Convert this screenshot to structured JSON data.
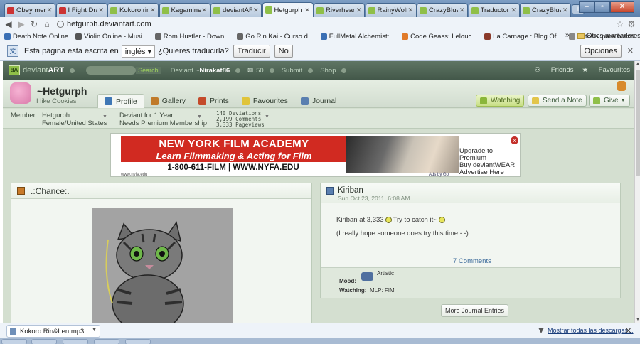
{
  "browser": {
    "tabs": [
      {
        "title": "Obey mem",
        "color": "#cc3333"
      },
      {
        "title": "I Fight Drag",
        "color": "#cc3333"
      },
      {
        "title": "Kokoro rin l",
        "color": "#8fbf48"
      },
      {
        "title": "Kagamine l",
        "color": "#8fbf48"
      },
      {
        "title": "deviantART",
        "color": "#8fbf48"
      },
      {
        "title": "Hetgurph o",
        "color": "#8fbf48",
        "active": true
      },
      {
        "title": "RiverheartS",
        "color": "#8fbf48"
      },
      {
        "title": "RainyWolfe",
        "color": "#8fbf48"
      },
      {
        "title": "CrazyBlueC",
        "color": "#8fbf48"
      },
      {
        "title": "Traductor d",
        "color": "#8fbf48"
      },
      {
        "title": "CrazyBlueC",
        "color": "#8fbf48"
      }
    ],
    "url": "hetgurph.deviantart.com",
    "bookmarks": [
      {
        "label": "Death Note Online",
        "color": "#3a6fb4"
      },
      {
        "label": "Violin Online - Musi...",
        "color": "#555555"
      },
      {
        "label": "Rom Hustler - Down...",
        "color": "#666666"
      },
      {
        "label": "Go Rin Kai - Curso d...",
        "color": "#666666"
      },
      {
        "label": "FullMetal Alchemist:...",
        "color": "#3a6fb4"
      },
      {
        "label": "Code Geass: Lelouc...",
        "color": "#e07a2a"
      },
      {
        "label": "La Carnage : Blog Of...",
        "color": "#8a3a2a"
      },
      {
        "label": "Tutorial para brazo ...",
        "color": "#888888"
      }
    ],
    "bookmarks_more": "»",
    "other_bookmarks": "Otros marcadores"
  },
  "translate_bar": {
    "prefix": "Esta página está escrita en",
    "language": "inglés",
    "question": "¿Quieres traducirla?",
    "translate_btn": "Traducir",
    "no_btn": "No",
    "options_btn": "Opciones",
    "close": "✕"
  },
  "da_nav": {
    "logo_a": "deviant",
    "logo_b": "ART",
    "search_btn": "Search",
    "deviant_label": "Deviant",
    "username": "~Nirakat86",
    "messages_count": "50",
    "submit": "Submit",
    "shop": "Shop",
    "friends": "Friends",
    "favourites": "Favourites"
  },
  "profile": {
    "username": "~Hetgurph",
    "tagline": "I like Cookies",
    "tabs": [
      {
        "label": "Profile",
        "color": "#3f77b5",
        "active": true
      },
      {
        "label": "Gallery",
        "color": "#c07a2a"
      },
      {
        "label": "Prints",
        "color": "#c44a2a"
      },
      {
        "label": "Favourites",
        "color": "#e0c43a"
      },
      {
        "label": "Journal",
        "color": "#5a7fb0"
      }
    ],
    "watching_btn": "Watching",
    "send_note_btn": "Send a Note",
    "give_btn": "Give"
  },
  "stats": {
    "member_label": "Member",
    "member_name": "Hetgurph",
    "member_loc": "Female/United States",
    "deviant_for": "Deviant for 1 Year",
    "premium_note": "Needs Premium Membership",
    "deviations": "140 Deviations",
    "comments": "2,199 Comments",
    "pageviews": "3,333 Pageviews"
  },
  "ad": {
    "title": "NEW YORK FILM ACADEMY",
    "subtitle": "Learn Filmmaking & Acting for Film",
    "phone": "1-800-611-FILM  |  WWW.NYFA.EDU",
    "url_small": "www.nyfa.edu",
    "ads_by": "Ads by Go",
    "side_line1": "Upgrade to Premium",
    "side_line2": "Buy deviantWEAR",
    "side_line3": "Advertise Here",
    "close": "x"
  },
  "left_panel": {
    "title": ".:Chance:."
  },
  "journal": {
    "title": "Kiriban",
    "date": "Sun Oct 23, 2011, 6:08 AM",
    "line1_a": "Kiriban at 3,333",
    "line1_b": "Try to catch it~",
    "line2": "(I really hope someone does try this time -.-)",
    "comments_link": "7 Comments",
    "mood_label": "Mood:",
    "mood_value": "Artistic",
    "watching_label": "Watching:",
    "watching_value": "MLP: FIM",
    "more_btn": "More Journal Entries"
  },
  "downloads": {
    "file": "Kokoro Rin&Len.mp3",
    "show_all": "Mostrar todas las descargas...",
    "close": "✕"
  }
}
